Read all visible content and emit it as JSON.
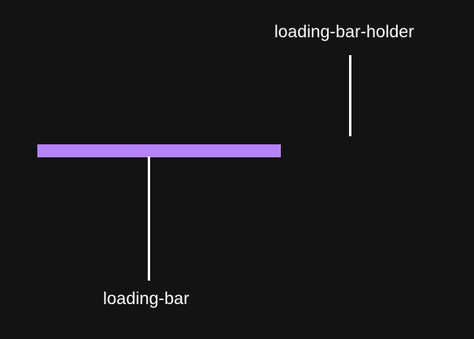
{
  "labels": {
    "holder": "loading-bar-holder",
    "bar": "loading-bar"
  },
  "loading_bar": {
    "progress_percent": 100,
    "fill_color": "#b583f7"
  },
  "colors": {
    "background": "#131313",
    "text": "#ffffff",
    "pointer": "#ffffff"
  }
}
